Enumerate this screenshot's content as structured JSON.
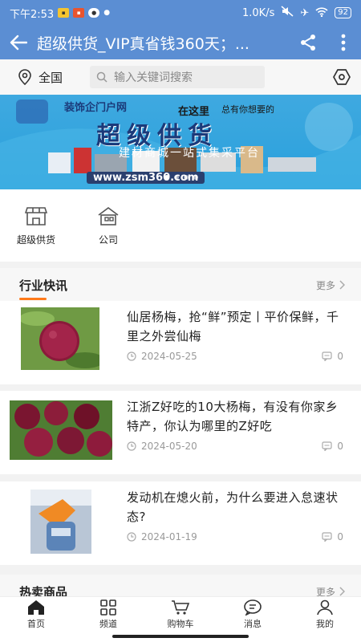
{
  "status": {
    "time": "下午2:53",
    "speed": "1.0K/s",
    "battery": "92"
  },
  "header": {
    "title": "超级供货_VIP真省钱360天；..."
  },
  "search": {
    "location": "全国",
    "placeholder": "输入关键词搜索"
  },
  "banner": {
    "logo_text": "装饰企门户网",
    "tagline_a": "在这里",
    "tagline_b": "总有你想要的",
    "headline": "超级供货",
    "subline": "建材商城一站式集采平台",
    "url": "www.zsm360.com"
  },
  "quick_links": [
    {
      "label": "超级供货",
      "icon": "shop-icon"
    },
    {
      "label": "公司",
      "icon": "building-icon"
    }
  ],
  "news_section": {
    "title": "行业快讯",
    "more": "更多",
    "items": [
      {
        "title": "仙居杨梅，抢“鲜”预定丨平价保鲜，千里之外尝仙梅",
        "date": "2024-05-25",
        "comments": "0"
      },
      {
        "title": "江浙Z好吃的10大杨梅，有没有你家乡特产，你认为哪里的Z好吃",
        "date": "2024-05-20",
        "comments": "0"
      },
      {
        "title": "发动机在熄火前，为什么要进入怠速状态?",
        "date": "2024-01-19",
        "comments": "0"
      }
    ]
  },
  "hot_section": {
    "title": "热卖商品",
    "more": "更多"
  },
  "tabbar": [
    {
      "label": "首页",
      "icon": "home-icon",
      "active": true
    },
    {
      "label": "频道",
      "icon": "grid-icon"
    },
    {
      "label": "购物车",
      "icon": "cart-icon"
    },
    {
      "label": "消息",
      "icon": "message-icon"
    },
    {
      "label": "我的",
      "icon": "user-icon"
    }
  ],
  "colors": {
    "header": "#5b8ed3",
    "accent": "#ff7a1a"
  }
}
